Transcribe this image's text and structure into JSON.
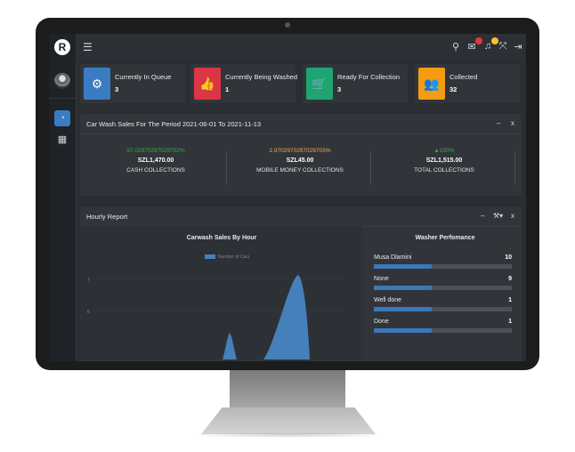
{
  "topbar": {
    "menu_icon": "hamburger-icon",
    "icons": [
      "search-icon",
      "chat-icon",
      "bell-icon",
      "expand-icon",
      "logout-icon",
      "grid-icon"
    ],
    "badge_colors": [
      "#e53935",
      "#fbc02d"
    ]
  },
  "sidebar": {
    "items": [
      {
        "icon": "dashboard-icon",
        "active": true
      },
      {
        "icon": "apps-grid-icon",
        "active": false
      }
    ]
  },
  "stats": [
    {
      "label": "Currently In Queue",
      "value": "3",
      "icon": "gear-icon",
      "color": "#3a7cc2"
    },
    {
      "label": "Currently Being Washed",
      "value": "1",
      "icon": "thumbs-up-icon",
      "color": "#dc3545"
    },
    {
      "label": "Ready For Collection",
      "value": "3",
      "icon": "cart-icon",
      "color": "#1ea571"
    },
    {
      "label": "Collected",
      "value": "32",
      "icon": "users-icon",
      "color": "#f39c12"
    }
  ],
  "sales": {
    "title": "Car Wash Sales For The Period 2021-06-01 To 2021-11-13",
    "columns": [
      {
        "pct": "97.02970297029702%",
        "amount": "SZL1,470.00",
        "caption": "CASH COLLECTIONS",
        "color": "#2fb344"
      },
      {
        "pct": "2.9702970297029703%",
        "amount": "SZL45.00",
        "caption": "MOBILE MONEY COLLECTIONS",
        "color": "#f0ad4e"
      },
      {
        "pct": "▲100%",
        "amount": "SZL1,515.00",
        "caption": "TOTAL COLLECTIONS",
        "color": "#2fb344"
      }
    ]
  },
  "hourly": {
    "title": "Hourly Report",
    "tools": {
      "minimize": "–",
      "wrench": "⚒",
      "close": "x"
    }
  },
  "chart_data": {
    "type": "area",
    "title": "Carwash Sales By Hour",
    "xlabel": "",
    "ylabel": "",
    "legend": [
      "Number of Cars"
    ],
    "yticks": [
      "7",
      "6"
    ],
    "series": [
      {
        "name": "Number of Cars",
        "color": "#4680bb",
        "peaks": [
          {
            "x": "early",
            "y": 1
          },
          {
            "x": "late",
            "y": 7
          }
        ]
      }
    ]
  },
  "performance": {
    "title": "Washer Perfomance",
    "rows": [
      {
        "name": "Musa Dlamini",
        "count": "10",
        "fraction": 0.42
      },
      {
        "name": "None",
        "count": "9",
        "fraction": 0.42
      },
      {
        "name": "Well done",
        "count": "1",
        "fraction": 0.42
      },
      {
        "name": "Done",
        "count": "1",
        "fraction": 0.42
      }
    ]
  }
}
